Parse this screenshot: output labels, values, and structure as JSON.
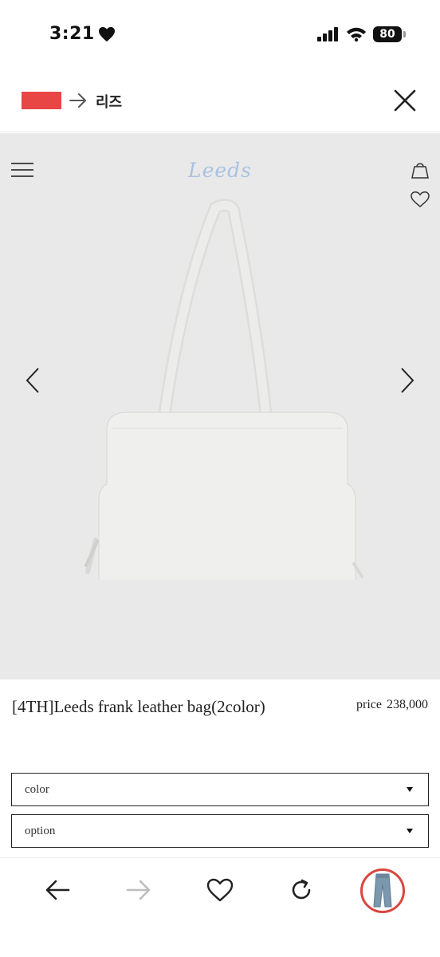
{
  "status_bar": {
    "time": "3:21",
    "battery": "80"
  },
  "translate_bar": {
    "source_lang_color": "#e84545",
    "target_lang": "리즈"
  },
  "site": {
    "brand": "Leeds",
    "brand_color": "#a9c2e0"
  },
  "product": {
    "title": "[4TH]Leeds frank leather bag(2color)",
    "price_label": "price",
    "price_value": "238,000",
    "image": "white leather shoulder bag"
  },
  "options": [
    {
      "label": "color"
    },
    {
      "label": "option"
    }
  ],
  "toolbar": {
    "back": "arrow-left-icon",
    "forward": "arrow-right-icon",
    "favorite": "heart-icon",
    "refresh": "refresh-icon",
    "tab_thumbnail": "jeans-thumbnail",
    "accent": "#d9463e"
  }
}
